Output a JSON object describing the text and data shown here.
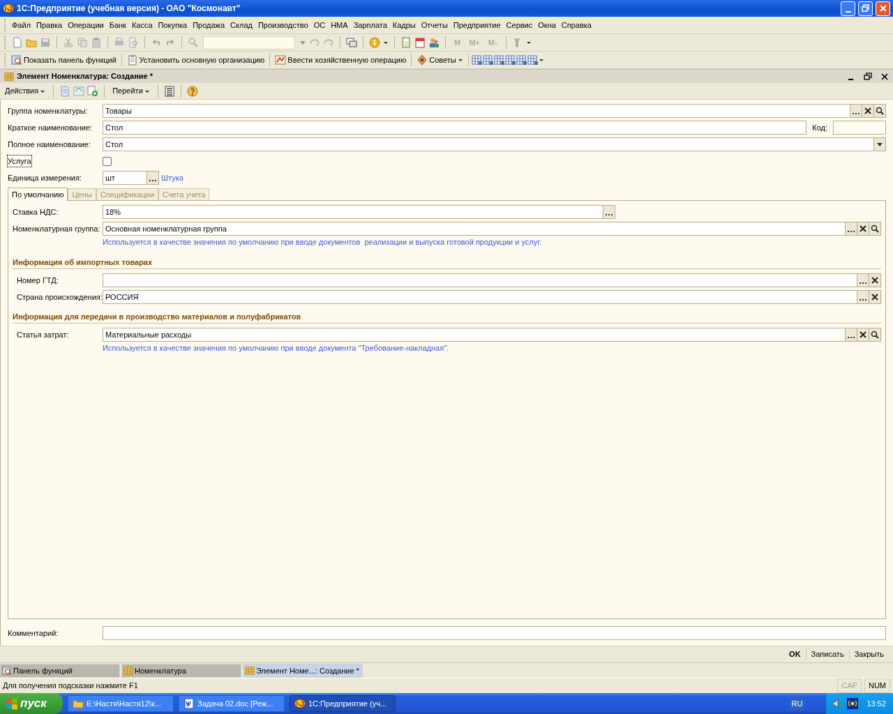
{
  "window": {
    "title": "1С:Предприятие (учебная версия) - ОАО \"Космонавт\""
  },
  "menu": [
    "Файл",
    "Правка",
    "Операции",
    "Банк",
    "Касса",
    "Покупка",
    "Продажа",
    "Склад",
    "Производство",
    "ОС",
    "НМА",
    "Зарплата",
    "Кадры",
    "Отчеты",
    "Предприятие",
    "Сервис",
    "Окна",
    "Справка"
  ],
  "memory_buttons": [
    {
      "label": "M",
      "disabled": true
    },
    {
      "label": "M+",
      "disabled": true
    },
    {
      "label": "M-",
      "disabled": true
    }
  ],
  "quick_buttons": [
    {
      "label": "Показать панель функций",
      "kind": "panel"
    },
    {
      "label": "Установить основную организацию",
      "kind": "clipboard"
    },
    {
      "label": "Ввести хозяйственную операцию",
      "kind": "operation"
    },
    {
      "label": "Советы",
      "kind": "tips"
    }
  ],
  "form": {
    "title": "Элемент Номенклатура: Создание *",
    "toolbar_menus": [
      "Действия",
      "Перейти"
    ],
    "fields": [
      {
        "kind": "field",
        "label": "Группа номенклатуры:",
        "value": "Товары",
        "buttons": [
          {
            "kind": "choose"
          },
          {
            "kind": "clear"
          },
          {
            "kind": "search"
          }
        ]
      },
      {
        "kind": "code_field",
        "label": "Краткое наименование:",
        "value": "Стол",
        "code_label": "Код:"
      },
      {
        "kind": "combo",
        "label": "Полное наименование:",
        "value": "Стол"
      },
      {
        "kind": "checkbox",
        "label": "Услуга",
        "checked": false,
        "focused": true
      },
      {
        "kind": "unit",
        "label": "Единица измерения:",
        "value": "шт",
        "buttons": [
          {
            "kind": "choose"
          }
        ],
        "link": "Штука"
      }
    ],
    "tabs": [
      {
        "label": "По умолчанию",
        "selected": true
      },
      {
        "label": "Цены",
        "selected": false
      },
      {
        "label": "Спецификации",
        "selected": false
      },
      {
        "label": "Счета учета",
        "selected": false
      }
    ],
    "tab_content": [
      {
        "kind": "short_field",
        "label": "Ставка НДС:",
        "value": "18%",
        "buttons": [
          {
            "kind": "choose"
          }
        ]
      },
      {
        "kind": "field",
        "label": "Номенклатурная группа:",
        "value": "Основная номенклатурная группа",
        "buttons": [
          {
            "kind": "choose"
          },
          {
            "kind": "clear"
          },
          {
            "kind": "search"
          }
        ]
      },
      {
        "kind": "hint",
        "text": "Используется в качестве значения по умолчанию при вводе документов  реализации и выпуска готовой продукции и услуг."
      },
      {
        "kind": "heading",
        "text": "Информация об импортных товарах"
      },
      {
        "kind": "group_field",
        "label": "Номер ГТД:",
        "buttons": [
          {
            "kind": "choose"
          },
          {
            "kind": "clear"
          }
        ]
      },
      {
        "kind": "group_field",
        "label": "Страна происхождения:",
        "value": "РОССИЯ",
        "buttons": [
          {
            "kind": "choose"
          },
          {
            "kind": "clear"
          }
        ]
      },
      {
        "kind": "heading",
        "text": "Информация для передачи в производство материалов и полуфабрикатов"
      },
      {
        "kind": "group_field",
        "label": "Статья затрат:",
        "value": "Материальные расходы",
        "buttons": [
          {
            "kind": "choose"
          },
          {
            "kind": "clear"
          },
          {
            "kind": "search"
          }
        ]
      },
      {
        "kind": "hint",
        "text": "Используется в качестве значения по умолчанию при вводе документа \"Требование-накладная\"."
      }
    ],
    "comment": {
      "label": "Комментарий:"
    },
    "buttons": [
      {
        "label": "OK",
        "default": true
      },
      {
        "label": "Записать",
        "default": false
      },
      {
        "label": "Закрыть",
        "default": false
      }
    ]
  },
  "window_tabs": [
    {
      "label": "Панель функций",
      "kind": "panel",
      "selected": false
    },
    {
      "label": "Номенклатура",
      "kind": "form",
      "selected": false
    },
    {
      "label": "Элемент Номе...: Создание *",
      "kind": "form",
      "selected": true
    }
  ],
  "status": {
    "hint": "Для получения подсказки нажмите F1",
    "indicators": [
      {
        "label": "CAP",
        "on": false
      },
      {
        "label": "NUM",
        "on": true
      }
    ]
  },
  "taskbar": {
    "start": "пуск",
    "items": [
      {
        "label": "E:\\Настя\\Настя12\\к...",
        "kind": "folder",
        "selected": false
      },
      {
        "label": "Задача 02.doc [Реж...",
        "kind": "word",
        "selected": false
      },
      {
        "label": "1С:Предприятие (уч...",
        "kind": "app",
        "selected": true
      }
    ],
    "language": "RU",
    "clock": "13:52"
  }
}
